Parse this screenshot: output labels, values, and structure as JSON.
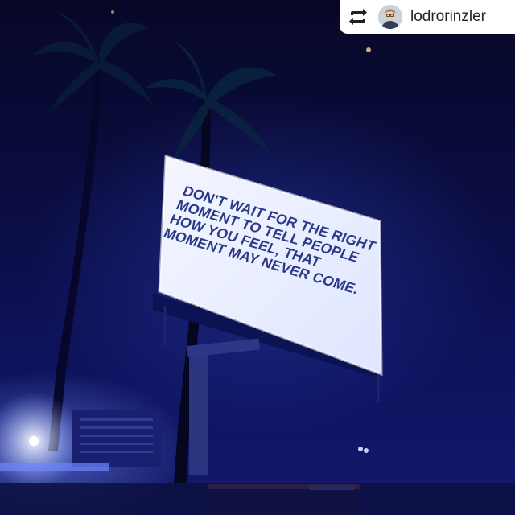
{
  "repost": {
    "icon": "repost-icon",
    "username": "lodrorinzler"
  },
  "billboard": {
    "lines": [
      "DON'T WAIT FOR THE RIGHT",
      "MOMENT TO TELL PEOPLE",
      "HOW YOU FEEL, THAT",
      "MOMENT MAY NEVER COME."
    ]
  },
  "colors": {
    "sky": "#0b0d45",
    "billboard_face": "#eef2ff",
    "billboard_text": "#2b3a86",
    "badge_bg": "#ffffff"
  }
}
